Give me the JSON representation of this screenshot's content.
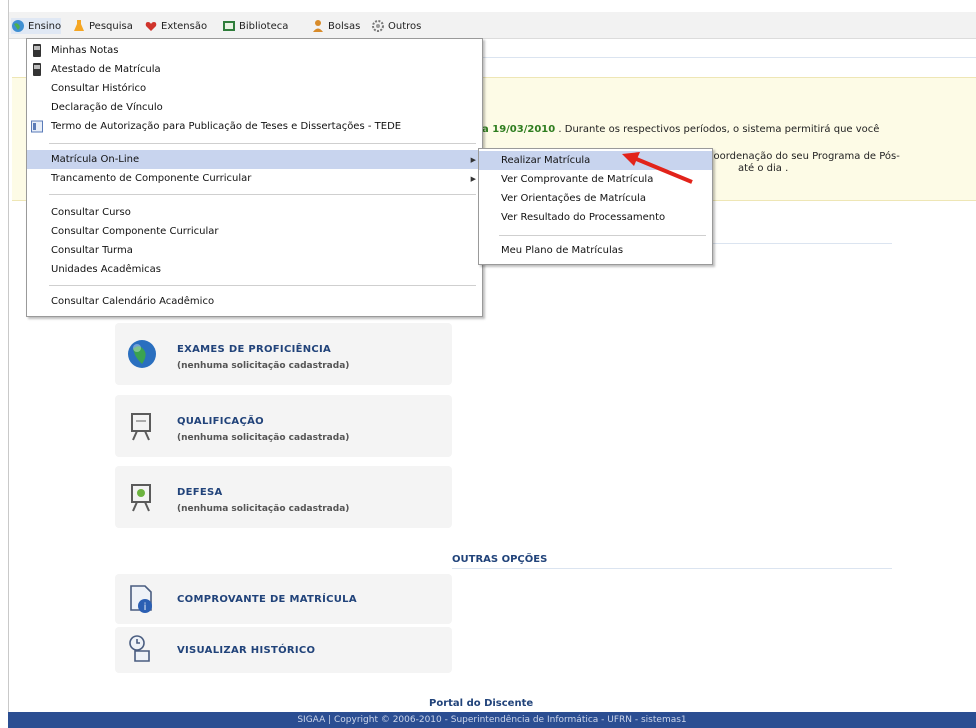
{
  "menubar": {
    "items": [
      {
        "label": "Ensino",
        "icon": "globe-icon"
      },
      {
        "label": "Pesquisa",
        "icon": "flask-icon"
      },
      {
        "label": "Extensão",
        "icon": "heart-icon"
      },
      {
        "label": "Biblioteca",
        "icon": "library-icon"
      },
      {
        "label": "Bolsas",
        "icon": "person-icon"
      },
      {
        "label": "Outros",
        "icon": "gear-icon"
      }
    ]
  },
  "ensino_menu": {
    "items": [
      {
        "label": "Minhas Notas",
        "icon": "phone-icon"
      },
      {
        "label": "Atestado de Matrícula",
        "icon": "phone-icon"
      },
      {
        "label": "Consultar Histórico"
      },
      {
        "label": "Declaração de Vínculo"
      },
      {
        "label": "Termo de Autorização para Publicação de Teses e Dissertações - TEDE",
        "icon": "doc-icon"
      },
      {
        "label": "Matrícula On-Line"
      },
      {
        "label": "Trancamento de Componente Curricular"
      },
      {
        "label": "Consultar Curso"
      },
      {
        "label": "Consultar Componente Curricular"
      },
      {
        "label": "Consultar Turma"
      },
      {
        "label": "Unidades Acadêmicas"
      },
      {
        "label": "Consultar Calendário Acadêmico"
      }
    ]
  },
  "matricula_submenu": {
    "items": [
      {
        "label": "Realizar Matrícula"
      },
      {
        "label": "Ver Comprovante de Matrícula"
      },
      {
        "label": "Ver Orientações de Matrícula"
      },
      {
        "label": "Ver Resultado do Processamento"
      },
      {
        "label": "Meu Plano de Matrículas"
      }
    ]
  },
  "notice": {
    "line1_date": "a 19/03/2010",
    "line1_rest": ". Durante os respectivos períodos, o sistema permitirá que você",
    "line2": "coordenação do seu Programa de Pós-",
    "line3": "até o dia ."
  },
  "cards": [
    {
      "title": "Exames de Proficiência",
      "subtitle": "(nenhuma solicitação cadastrada)",
      "icon": "globe-icon"
    },
    {
      "title": "Qualificação",
      "subtitle": "(nenhuma solicitação cadastrada)",
      "icon": "presentation-board-icon"
    },
    {
      "title": "Defesa",
      "subtitle": "(nenhuma solicitação cadastrada)",
      "icon": "presentation-board-icon"
    }
  ],
  "outras_opcoes": {
    "title": "OUTRAS OPÇÕES",
    "cards": [
      {
        "title": "Comprovante de Matrícula",
        "icon": "document-info-icon"
      },
      {
        "title": "Visualizar Histórico",
        "icon": "clock-scroll-icon"
      }
    ]
  },
  "portal_label": "Portal do Discente",
  "footer_text": "SIGAA | Copyright © 2006-2010 - Superintendência de Informática - UFRN - sistemas1",
  "colors": {
    "accent": "#21437a",
    "footer": "#2b4e92",
    "highlight": "#c8d4ee",
    "notice_bg": "#fdfbe6"
  }
}
